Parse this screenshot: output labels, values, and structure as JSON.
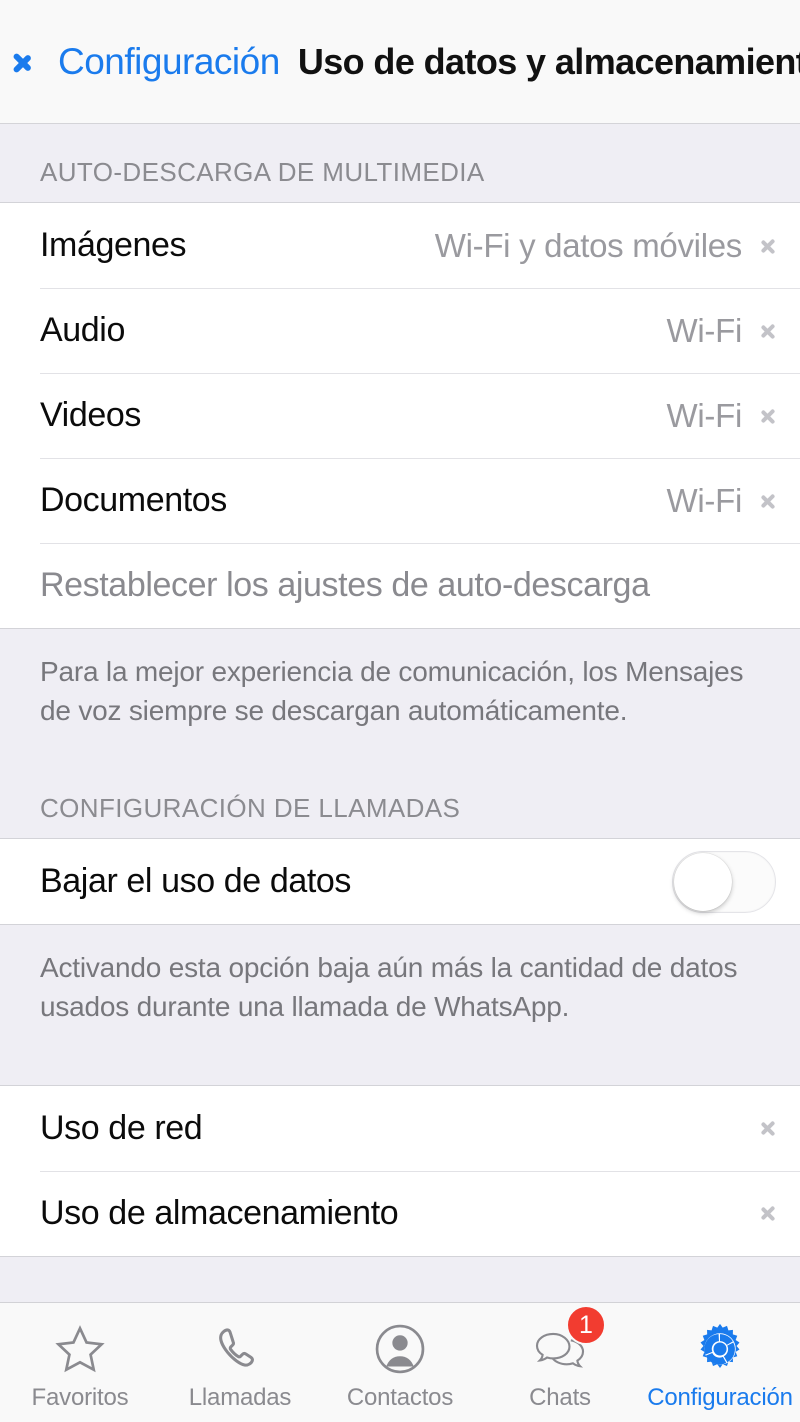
{
  "navbar": {
    "back_label": "Configuración",
    "title": "Uso de datos y almacenamiento",
    "back_icon": "chevron-left-icon",
    "accent_color": "#1a7bed"
  },
  "sections": [
    {
      "header": "AUTO-DESCARGA DE MULTIMEDIA",
      "rows": [
        {
          "label": "Imágenes",
          "value": "Wi-Fi y datos móviles",
          "chevron": true
        },
        {
          "label": "Audio",
          "value": "Wi-Fi",
          "chevron": true
        },
        {
          "label": "Videos",
          "value": "Wi-Fi",
          "chevron": true
        },
        {
          "label": "Documentos",
          "value": "Wi-Fi",
          "chevron": true
        },
        {
          "label": "Restablecer los ajustes de auto-descarga",
          "value": "",
          "chevron": false,
          "muted": true
        }
      ],
      "footnote": "Para la mejor experiencia de comunicación, los Mensajes de voz siempre se descargan automáticamente."
    },
    {
      "header": "CONFIGURACIÓN DE LLAMADAS",
      "rows": [
        {
          "label": "Bajar el uso de datos",
          "toggle": true,
          "toggle_on": false
        }
      ],
      "footnote": "Activando esta opción baja aún más la cantidad de datos usados durante una llamada de WhatsApp."
    },
    {
      "header": "",
      "rows": [
        {
          "label": "Uso de red",
          "value": "",
          "chevron": true
        },
        {
          "label": "Uso de almacenamiento",
          "value": "",
          "chevron": true
        }
      ],
      "footnote": ""
    }
  ],
  "tabbar": {
    "items": [
      {
        "label": "Favoritos",
        "icon": "star-outline-icon",
        "active": false,
        "badge": ""
      },
      {
        "label": "Llamadas",
        "icon": "phone-icon",
        "active": false,
        "badge": ""
      },
      {
        "label": "Contactos",
        "icon": "contact-circle-icon",
        "active": false,
        "badge": ""
      },
      {
        "label": "Chats",
        "icon": "chat-bubbles-icon",
        "active": false,
        "badge": "1"
      },
      {
        "label": "Configuración",
        "icon": "gear-icon",
        "active": true,
        "badge": ""
      }
    ],
    "badge_color": "#f23c30",
    "active_color": "#1a7bed",
    "inactive_color": "#8a8a8f"
  }
}
